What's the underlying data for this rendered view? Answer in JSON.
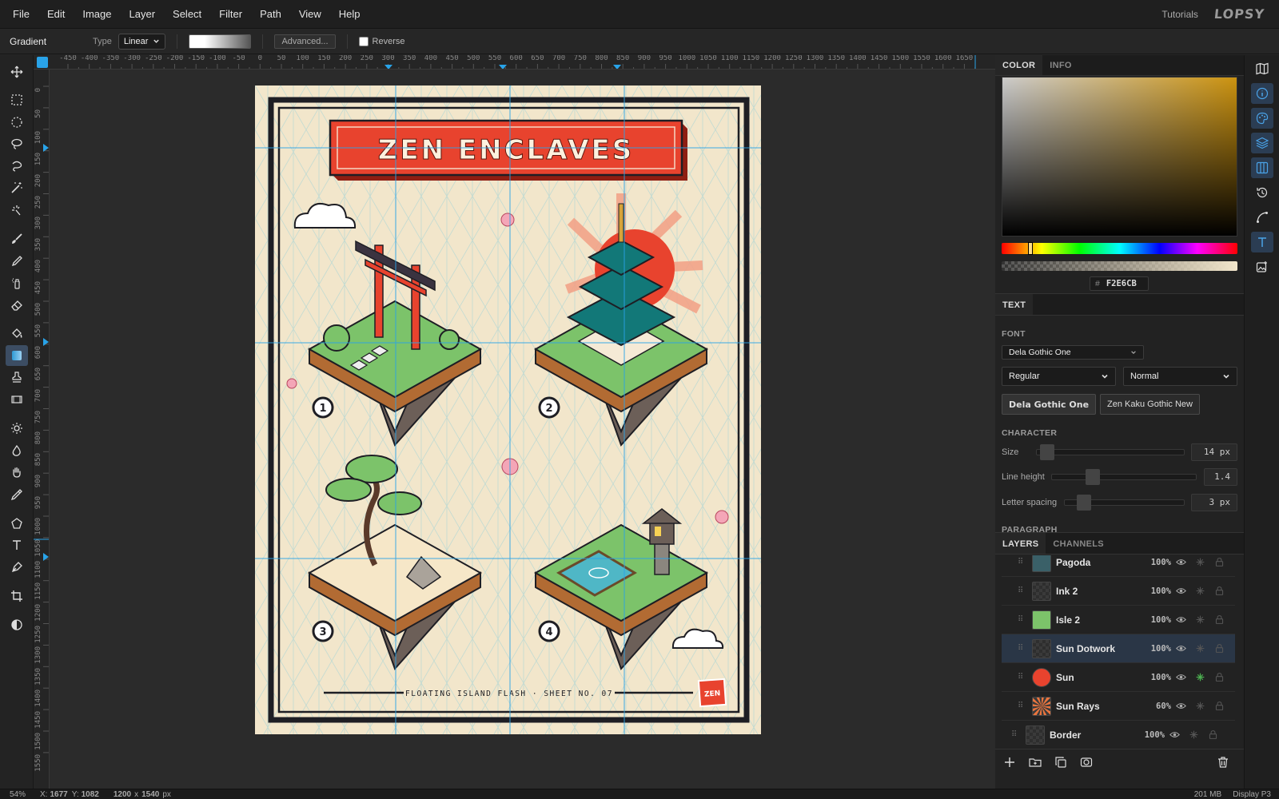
{
  "menu": [
    "File",
    "Edit",
    "Image",
    "Layer",
    "Select",
    "Filter",
    "Path",
    "View",
    "Help"
  ],
  "header": {
    "tutorials": "Tutorials",
    "logo": "LOPSY"
  },
  "options": {
    "tool_name": "Gradient",
    "type_label": "Type",
    "type_value": "Linear",
    "advanced": "Advanced...",
    "reverse": "Reverse"
  },
  "ruler_h": [
    "-450",
    "-400",
    "-350",
    "-300",
    "-250",
    "-200",
    "-150",
    "-100",
    "-50",
    "0",
    "50",
    "100",
    "150",
    "200",
    "250",
    "300",
    "350",
    "400",
    "450",
    "500",
    "550",
    "600",
    "650",
    "700",
    "750",
    "800",
    "850",
    "900",
    "950",
    "1000",
    "1050",
    "1100",
    "1150",
    "1200",
    "1250",
    "1300",
    "1350",
    "1400",
    "1450",
    "1500",
    "1550",
    "1600",
    "1650"
  ],
  "ruler_v": [
    "0",
    "50",
    "100",
    "150",
    "200",
    "250",
    "300",
    "350",
    "400",
    "450",
    "500",
    "550",
    "600",
    "650",
    "700",
    "750",
    "800",
    "850",
    "900",
    "950",
    "1000",
    "1050",
    "1100",
    "1150",
    "1200",
    "1250",
    "1300",
    "1350",
    "1400",
    "1450",
    "1500",
    "1550"
  ],
  "poster": {
    "title": "ZEN ENCLAVES",
    "footer": "FLOATING ISLAND FLASH  ·  SHEET NO. 07",
    "stamp": "ZEN",
    "badges": [
      "1",
      "2",
      "3",
      "4"
    ]
  },
  "color_panel": {
    "tabs": [
      "COLOR",
      "INFO"
    ],
    "hex_prefix": "#",
    "hex": "F2E6CB"
  },
  "text_panel": {
    "tab": "TEXT",
    "font_label": "FONT",
    "font_family": "Dela Gothic One",
    "weight": "Regular",
    "style": "Normal",
    "font_buttons": [
      "Dela Gothic One",
      "Zen Kaku Gothic New"
    ],
    "character_label": "CHARACTER",
    "size_label": "Size",
    "size_value": "14 px",
    "line_height_label": "Line height",
    "line_height_value": "1.4",
    "letter_spacing_label": "Letter spacing",
    "letter_spacing_value": "3 px",
    "paragraph_label": "PARAGRAPH"
  },
  "layers_panel": {
    "tabs": [
      "LAYERS",
      "CHANNELS"
    ],
    "layers": [
      {
        "name": "Pagoda",
        "opacity": "100%"
      },
      {
        "name": "Ink 2",
        "opacity": "100%"
      },
      {
        "name": "Isle 2",
        "opacity": "100%"
      },
      {
        "name": "Sun Dotwork",
        "opacity": "100%"
      },
      {
        "name": "Sun",
        "opacity": "100%"
      },
      {
        "name": "Sun Rays",
        "opacity": "60%"
      },
      {
        "name": "Border",
        "opacity": "100%"
      }
    ]
  },
  "status": {
    "zoom": "54%",
    "x_label": "X:",
    "x": "1677",
    "y_label": "Y:",
    "y": "1082",
    "w": "1200",
    "x_sep": "x",
    "h": "1540",
    "unit": "px",
    "memory": "201 MB",
    "profile": "Display P3"
  },
  "colors": {
    "accent": "#2f9bd6",
    "poster_bg": "#f2e6cb",
    "poster_red": "#e8432e",
    "guide": "#29a3e8"
  }
}
